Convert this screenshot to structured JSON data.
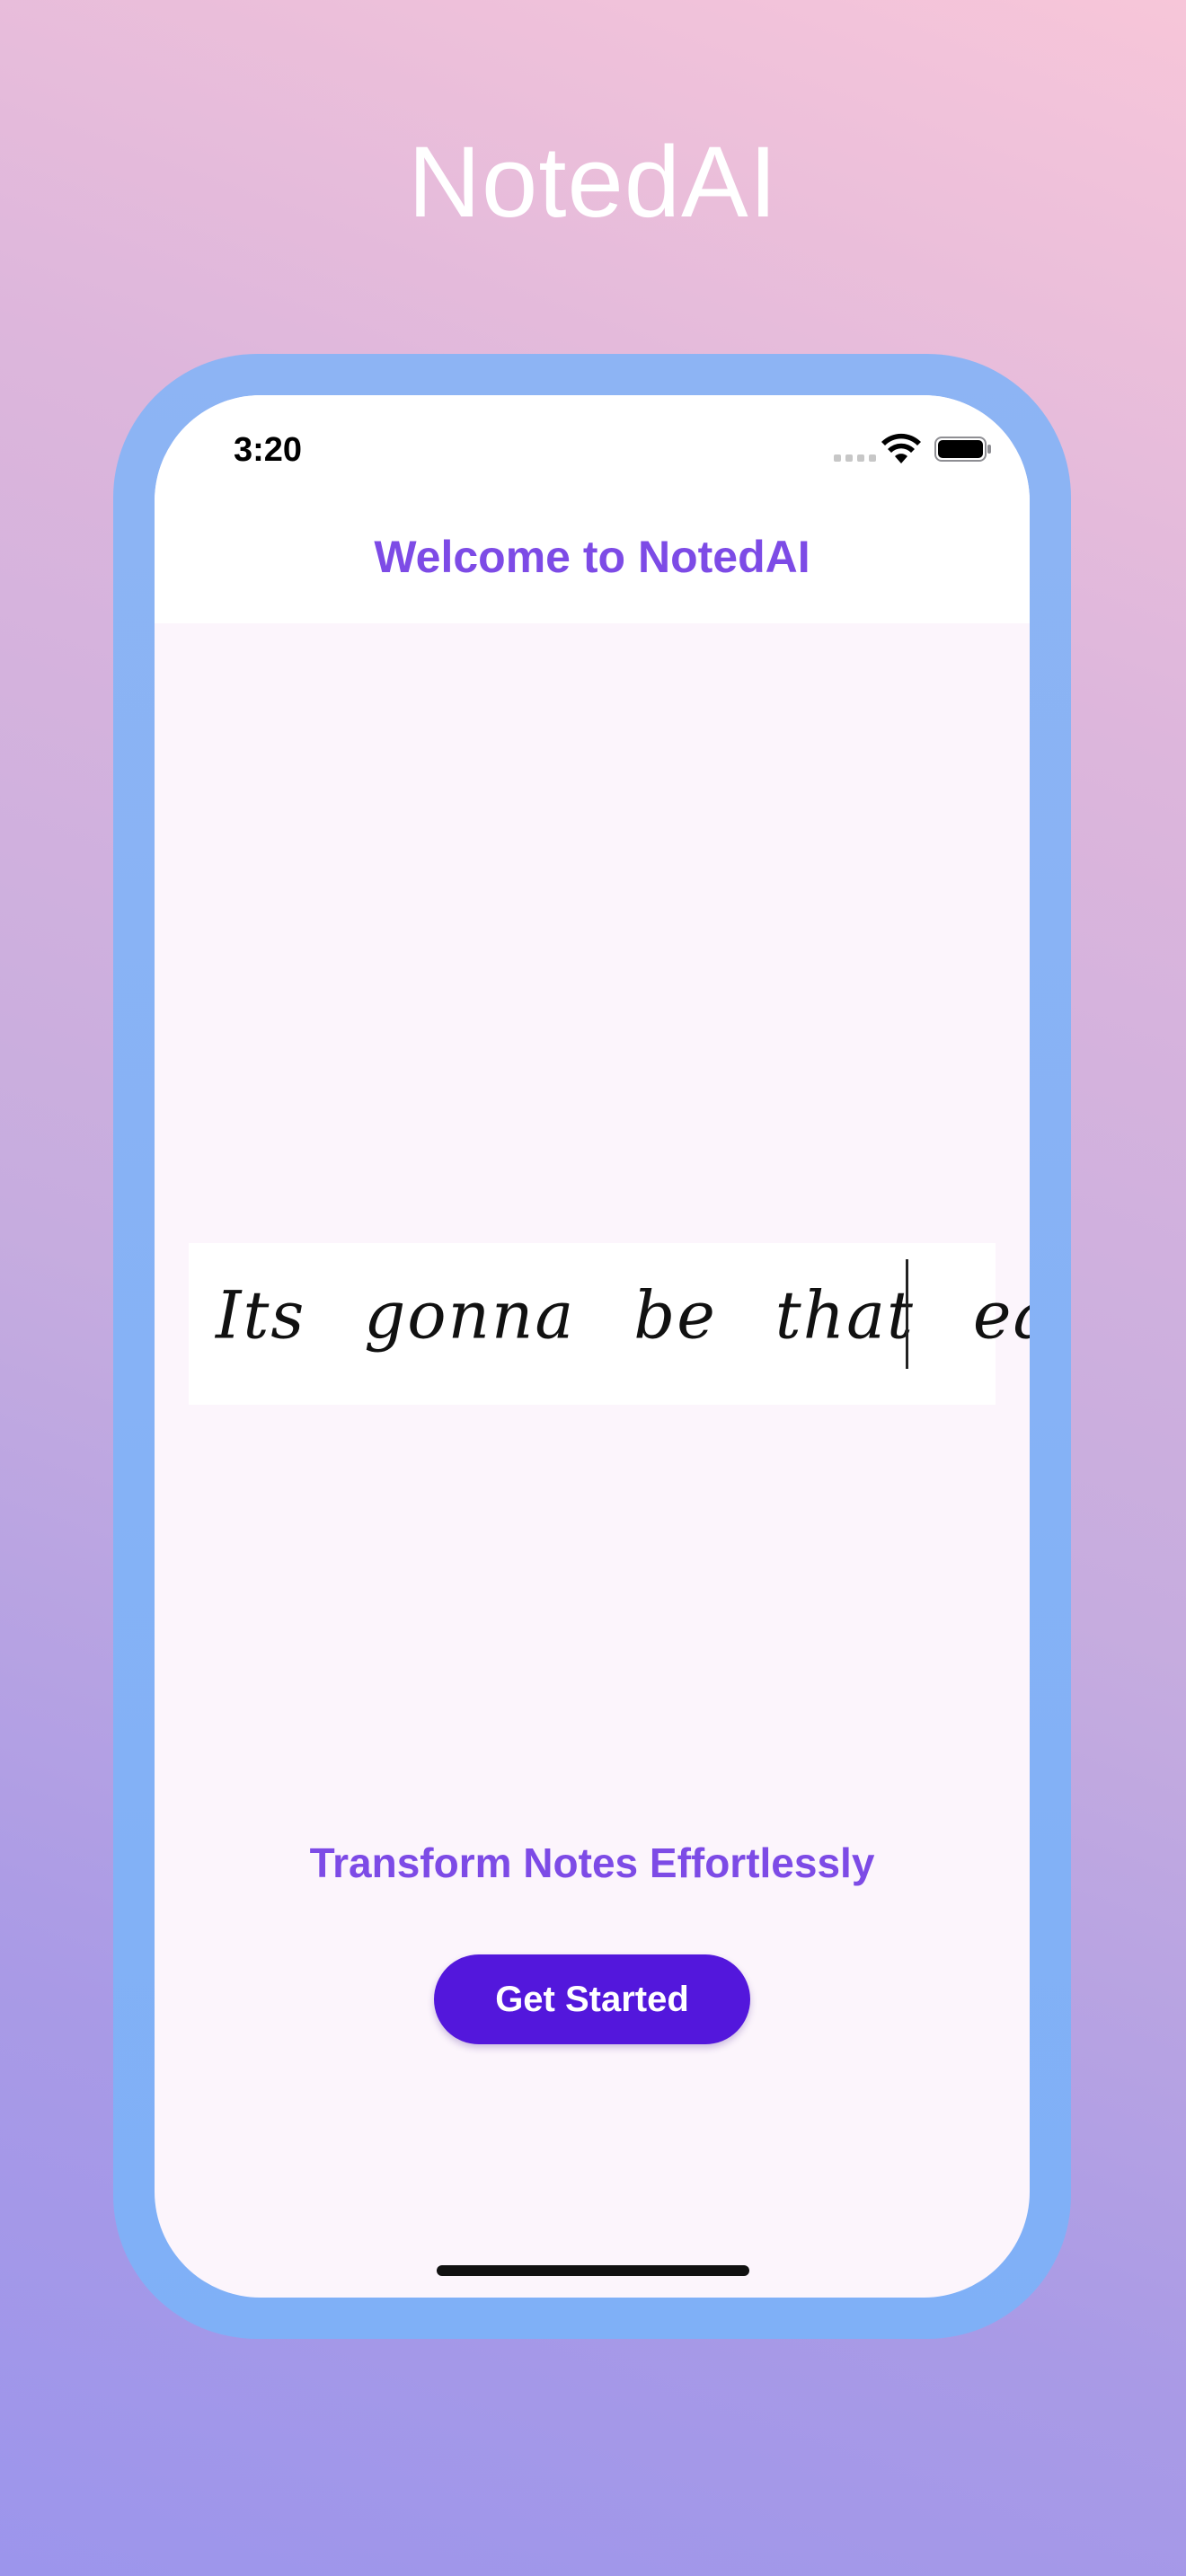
{
  "app": {
    "title": "NotedAI"
  },
  "status_bar": {
    "time": "3:20"
  },
  "screen": {
    "nav_title": "Welcome to NotedAI",
    "handwriting_text": "Its gonna be that easy",
    "tagline": "Transform Notes Effortlessly",
    "cta_label": "Get Started"
  },
  "colors": {
    "accent": "#7d4be6",
    "button": "#5317dc",
    "frame": "#8db4f4",
    "screen_background": "#fcf5fc"
  },
  "icons": [
    "signal-icon",
    "wifi-icon",
    "battery-icon"
  ]
}
